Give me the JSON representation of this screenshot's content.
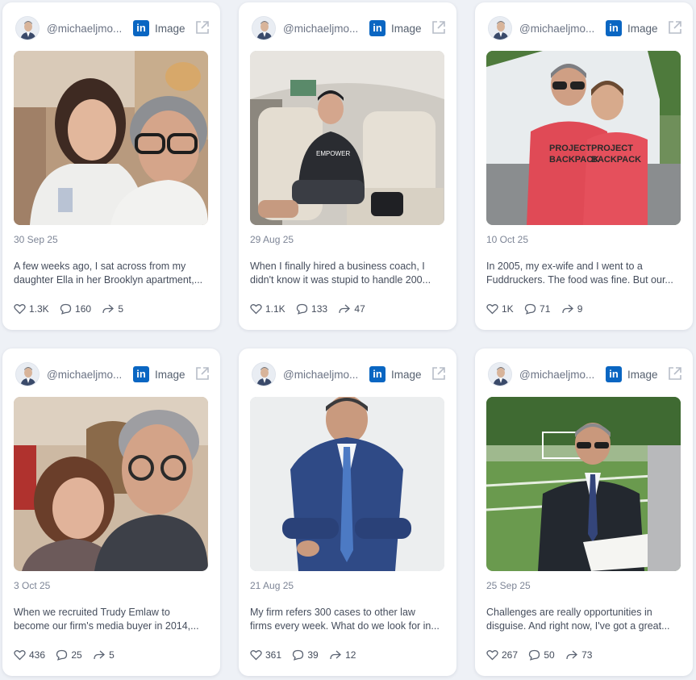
{
  "cards": [
    {
      "handle": "@michaeljmo...",
      "network": "in",
      "type": "Image",
      "date": "30 Sep 25",
      "excerpt": [
        "A few weeks ago, I sat across from my",
        "daughter Ella in her Brooklyn apartment,..."
      ],
      "likes": "1.3K",
      "comments": "160",
      "shares": "5"
    },
    {
      "handle": "@michaeljmo...",
      "network": "in",
      "type": "Image",
      "date": "29 Aug 25",
      "excerpt": [
        "When I finally hired a business coach, I",
        "didn't know it was stupid to handle 200..."
      ],
      "likes": "1.1K",
      "comments": "133",
      "shares": "47"
    },
    {
      "handle": "@michaeljmo...",
      "network": "in",
      "type": "Image",
      "date": "10 Oct 25",
      "excerpt": [
        "In 2005, my ex-wife and I went to a",
        "Fuddruckers. The food was fine. But our..."
      ],
      "likes": "1K",
      "comments": "71",
      "shares": "9"
    },
    {
      "handle": "@michaeljmo...",
      "network": "in",
      "type": "Image",
      "date": "3 Oct 25",
      "excerpt": [
        "When we recruited Trudy Emlaw to",
        "become our firm's media buyer in 2014,..."
      ],
      "likes": "436",
      "comments": "25",
      "shares": "5"
    },
    {
      "handle": "@michaeljmo...",
      "network": "in",
      "type": "Image",
      "date": "21 Aug 25",
      "excerpt": [
        "My firm refers 300 cases to other law",
        "firms every week. What do we look for in..."
      ],
      "likes": "361",
      "comments": "39",
      "shares": "12"
    },
    {
      "handle": "@michaeljmo...",
      "network": "in",
      "type": "Image",
      "date": "25 Sep 25",
      "excerpt": [
        "Challenges are really opportunities in",
        "disguise. And right now, I've got a great..."
      ],
      "likes": "267",
      "comments": "50",
      "shares": "73"
    }
  ],
  "icons": {
    "like": "heart-icon",
    "comment": "comment-icon",
    "share": "share-arrow-icon",
    "external": "external-link-icon"
  },
  "photo_text": {
    "backpack_shirt": [
      "PROJECT",
      "BACKPACK"
    ]
  },
  "colors": {
    "linkedin": "#0a66c2",
    "background": "#eef1f6",
    "card": "#ffffff"
  }
}
